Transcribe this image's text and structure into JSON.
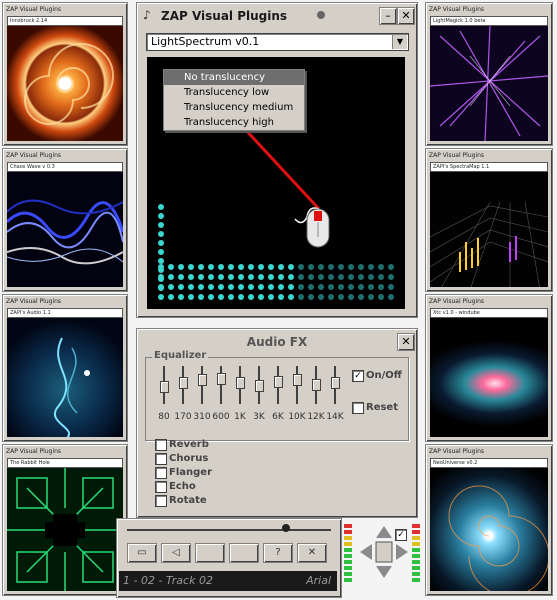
{
  "main_window": {
    "title": "ZAP Visual Plugins",
    "close_glyph": "✕",
    "minimize_glyph": "–",
    "plugin_select": "LightSpectrum v0.1",
    "translucency_menu": [
      "No translucency",
      "Translucency low",
      "Translucency medium",
      "Translucency high"
    ],
    "selected_index": 0
  },
  "side_windows": [
    {
      "title": "ZAP Visual Plugins",
      "plugin": "Innsbruck 2.14",
      "art": "swirl"
    },
    {
      "title": "ZAP Visual Plugins",
      "plugin": "Chaos Wave v 0.3",
      "art": "wave"
    },
    {
      "title": "ZAP Visual Plugins",
      "plugin": "ZAPI's Audio 1.1",
      "art": "fluid"
    },
    {
      "title": "ZAP Visual Plugins",
      "plugin": "The Rabbit Hole",
      "art": "hole"
    },
    {
      "title": "ZAP Visual Plugins",
      "plugin": "LightMagick 1.0 beta",
      "art": "purple"
    },
    {
      "title": "ZAP Visual Plugins",
      "plugin": "ZAPI's SpectraMap 1.1",
      "art": "grid"
    },
    {
      "title": "ZAP Visual Plugins",
      "plugin": "Xtc v1.0 - windube",
      "art": "nebula"
    },
    {
      "title": "ZAP Visual Plugins",
      "plugin": "NeoUniverse v0.2",
      "art": "galaxy"
    }
  ],
  "audio_fx": {
    "title": "Audio FX",
    "close_glyph": "✕",
    "equalizer_label": "Equalizer",
    "bands": [
      "80",
      "170",
      "310",
      "600",
      "1K",
      "3K",
      "6K",
      "10K",
      "12K",
      "14K"
    ],
    "band_levels": [
      0.45,
      0.6,
      0.7,
      0.75,
      0.6,
      0.5,
      0.65,
      0.7,
      0.55,
      0.6
    ],
    "onoff_label": "On/Off",
    "onoff_checked": true,
    "reset_label": "Reset",
    "effects": [
      "Reverb",
      "Chorus",
      "Flanger",
      "Echo",
      "Rotate"
    ]
  },
  "player": {
    "track": "1 - 02 - Track 02",
    "side_text": "Arial",
    "open_icon": "folder-icon",
    "mute_icon": "speaker-icon",
    "help_glyph": "?",
    "stop_glyph": "✕",
    "check_glyph": "✓",
    "position": 0.78
  }
}
